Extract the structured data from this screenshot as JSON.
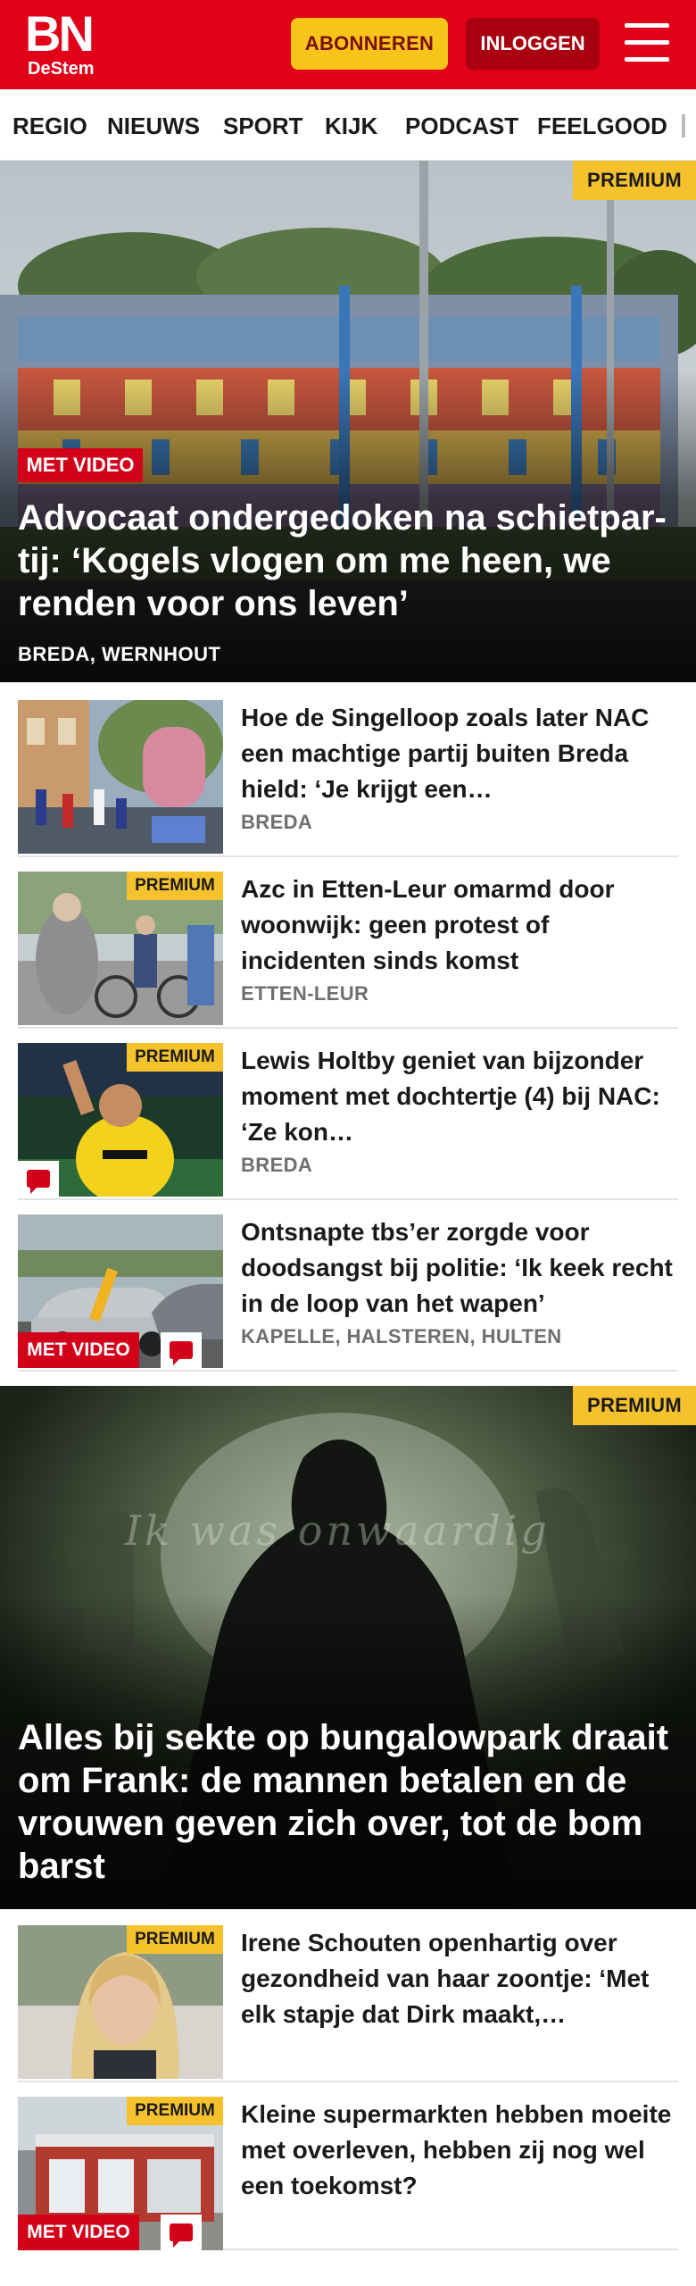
{
  "header": {
    "logo_main": "BN",
    "logo_sub": "DeStem",
    "subscribe_label": "ABONNEREN",
    "login_label": "INLOGGEN",
    "menu_icon": "hamburger-menu-icon"
  },
  "nav": {
    "items": [
      "REGIO",
      "NIEUWS",
      "SPORT",
      "KIJK",
      "PODCAST",
      "FEELGOOD"
    ]
  },
  "colors": {
    "brand_red": "#e00018",
    "premium_yellow": "#f5c22e",
    "video_red": "#d3001a"
  },
  "hero1": {
    "premium": "PREMIUM",
    "video": "MET VIDEO",
    "title": "Advocaat ondergedoken na schietpar­tij: ‘Kogels vlogen om me heen, we renden voor ons leven’",
    "location": "BREDA, WERNHOUT"
  },
  "articles": [
    {
      "title": "Hoe de Singelloop zoals later NAC een machtige partij buiten Breda hield: ‘Je krijgt een…",
      "location": "BREDA"
    },
    {
      "premium": "PREMIUM",
      "title": "Azc in Etten-Leur omarmd door woonwijk: geen protest of incidenten sinds komst",
      "location": "ETTEN-LEUR"
    },
    {
      "premium": "PREMIUM",
      "title": "Lewis Holtby geniet van bijzonder moment met dochtertje (4) bij NAC: ‘Ze kon…",
      "location": "BREDA",
      "comment_icon": "comment-icon"
    },
    {
      "video": "MET VIDEO",
      "title": "Ontsnapte tbs’er zorgde voor doodsangst bij politie: ‘Ik keek recht in de loop van het wapen’",
      "location": "KAPELLE, HALSTEREN, HULTEN",
      "comment_icon": "comment-icon"
    }
  ],
  "hero2": {
    "premium": "PREMIUM",
    "overlay_text": "Ik was onwaardig",
    "title": "Alles bij sekte op bungalowpark draait om Frank: de mannen betalen en de vrouwen geven zich over, tot de bom barst"
  },
  "articles2": [
    {
      "premium": "PREMIUM",
      "title": "Irene Schouten openhartig over gezondheid van haar zoontje: ‘Met elk stapje dat Dirk maakt,…"
    },
    {
      "premium": "PREMIUM",
      "video": "MET VIDEO",
      "title": "Kleine supermarkten hebben moeite met overleven, hebben zij nog wel een toekomst?",
      "comment_icon": "comment-icon"
    }
  ]
}
